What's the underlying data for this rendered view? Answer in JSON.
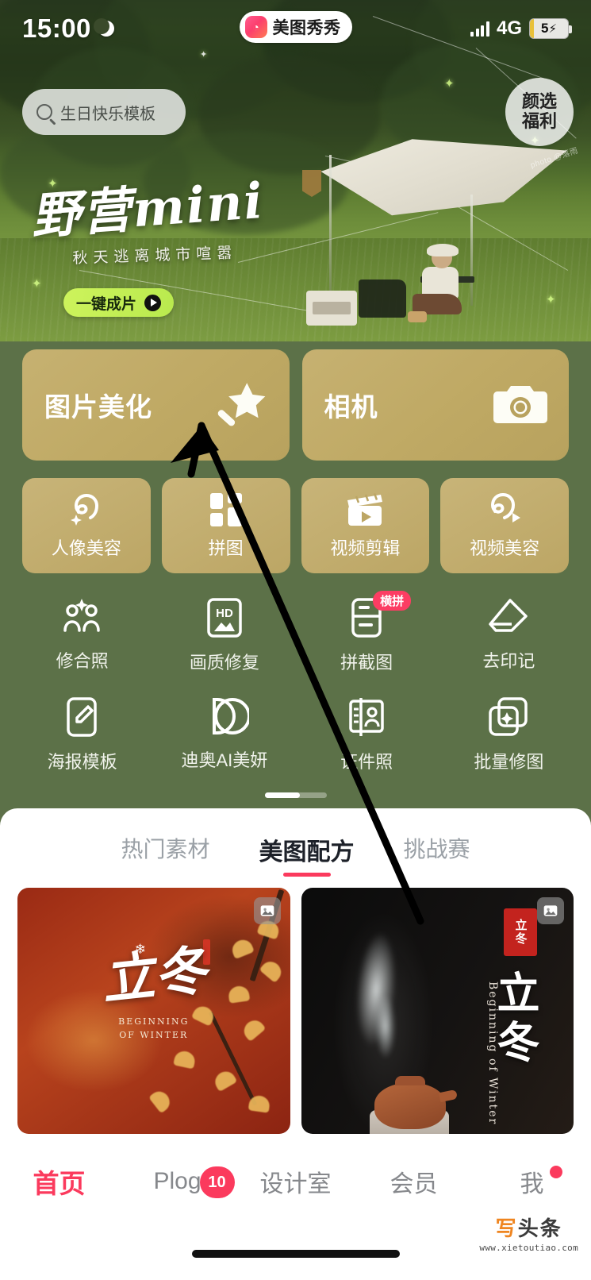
{
  "status_bar": {
    "time": "15:00",
    "moon_icon": "moon-icon",
    "app_pill": {
      "name": "美图秀秀",
      "icon": "meitu-app-icon"
    },
    "network": "4G",
    "signal_icon": "signal-bars-icon",
    "battery_level": "5",
    "battery_charging_icon": "⚡"
  },
  "hero": {
    "search": {
      "icon": "search-icon",
      "placeholder": "生日快乐模板"
    },
    "welfare_badge": {
      "line1": "颜选",
      "line2": "福利"
    },
    "title_main": "野营mini",
    "title_sub": "秋天逃离城市喧嚣",
    "cta_label": "一键成片",
    "cta_icon": "play-icon",
    "photo_credit": "photo @落雨"
  },
  "big_cards": [
    {
      "label": "图片美化",
      "icon": "magic-wand-star-icon"
    },
    {
      "label": "相机",
      "icon": "camera-icon"
    }
  ],
  "tiles": [
    {
      "label": "人像美容",
      "icon": "portrait-beauty-icon"
    },
    {
      "label": "拼图",
      "icon": "collage-icon"
    },
    {
      "label": "视频剪辑",
      "icon": "video-clapperboard-icon"
    },
    {
      "label": "视频美容",
      "icon": "video-beauty-icon"
    }
  ],
  "icon_grid": [
    {
      "label": "修合照",
      "icon": "group-photo-fix-icon",
      "badge": ""
    },
    {
      "label": "画质修复",
      "icon": "hd-restore-icon",
      "badge": ""
    },
    {
      "label": "拼截图",
      "icon": "screenshot-stitch-icon",
      "badge": "横拼"
    },
    {
      "label": "去印记",
      "icon": "eraser-icon",
      "badge": ""
    },
    {
      "label": "海报模板",
      "icon": "poster-template-icon",
      "badge": ""
    },
    {
      "label": "迪奥AI美妍",
      "icon": "dior-logo-icon",
      "badge": ""
    },
    {
      "label": "证件照",
      "icon": "id-photo-icon",
      "badge": ""
    },
    {
      "label": "批量修图",
      "icon": "batch-edit-icon",
      "badge": ""
    }
  ],
  "sheet": {
    "tabs": [
      {
        "label": "热门素材",
        "active": false
      },
      {
        "label": "美图配方",
        "active": true
      },
      {
        "label": "挑战赛",
        "active": false
      }
    ],
    "cards": [
      {
        "name": "lidong-red-card",
        "calligraphy": "立冬",
        "english": "BEGINNING\nOF WINTER",
        "badge_icon": "image-stack-icon"
      },
      {
        "name": "lidong-dark-card",
        "calligraphy": "立冬",
        "english": "Beginning of Winter",
        "seal": "立冬",
        "badge_icon": "image-stack-icon"
      }
    ]
  },
  "bottom_nav": [
    {
      "label": "首页",
      "active": true,
      "badge": "",
      "dot": false
    },
    {
      "label": "Plog",
      "active": false,
      "badge": "10",
      "dot": false
    },
    {
      "label": "设计室",
      "active": false,
      "badge": "",
      "dot": false
    },
    {
      "label": "会员",
      "active": false,
      "badge": "",
      "dot": false
    },
    {
      "label": "我",
      "active": false,
      "badge": "",
      "dot": true
    }
  ],
  "watermark": {
    "cn": "写头条",
    "url": "www.xietoutiao.com"
  },
  "colors": {
    "accent_red": "#fb3a5d",
    "card_gold": "#c1aa67",
    "panel_green": "#5c7148",
    "cta_green": "#cdf35c"
  }
}
